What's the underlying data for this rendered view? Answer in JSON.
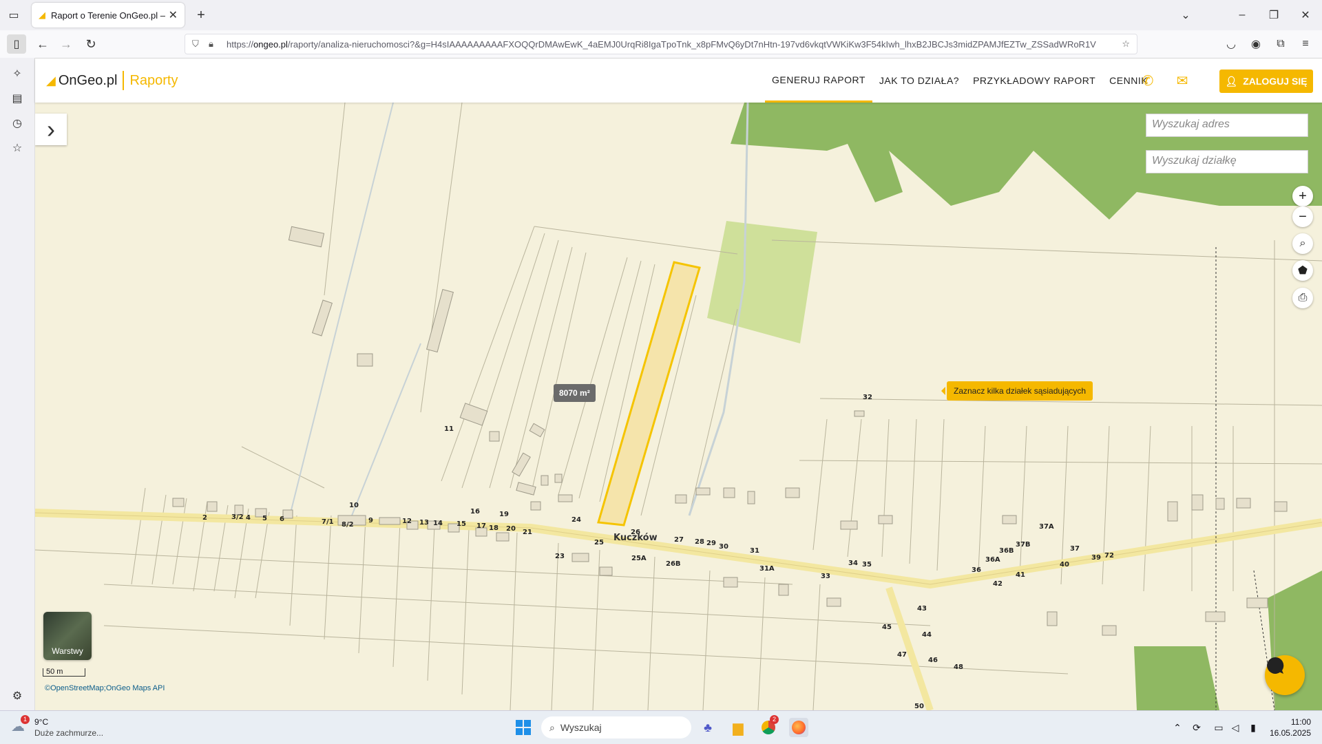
{
  "browser": {
    "tab_title": "Raport o Terenie OnGeo.pl – An",
    "new_tab_label": "+",
    "url_prefix": "https://",
    "url_domain": "ongeo.pl",
    "url_rest": "/raporty/analiza-nieruchomosci?&g=H4sIAAAAAAAAAFXOQQrDMAwEwK_4aEMJ0UrqRi8IgaTpoTnk_x8pFMvQ6yDt7nHtn-197vd6vkqtVWKiKw3F54kIwh_lhxB2JBCJs3midZPAMJfEZTw_ZSSadWRoR1V"
  },
  "site": {
    "logo_brand": "OnGeo.pl",
    "logo_section": "Raporty",
    "nav": [
      "GENERUJ RAPORT",
      "JAK TO DZIAŁA?",
      "PRZYKŁADOWY RAPORT",
      "CENNIK"
    ],
    "login_label": "ZALOGUJ SIĘ",
    "accent_color": "#f5b800"
  },
  "map": {
    "search_address_placeholder": "Wyszukaj adres",
    "search_parcel_placeholder": "Wyszukaj działkę",
    "area_label": "8070 m²",
    "hint_label": "Zaznacz kilka działek sąsiadujących",
    "layers_label": "Warstwy",
    "scale_label": "50 m",
    "attribution": "©OpenStreetMap;OnGeo Maps API",
    "street_label": "Kuczków",
    "house_numbers": [
      "2",
      "3/2",
      "4",
      "5",
      "6",
      "7/1",
      "8/2",
      "9",
      "10",
      "11",
      "12",
      "13",
      "14",
      "15",
      "16",
      "17",
      "18",
      "19",
      "20",
      "21",
      "23",
      "24",
      "25",
      "25A",
      "26",
      "26B",
      "27",
      "28",
      "29",
      "30",
      "31",
      "31A",
      "32",
      "33",
      "34",
      "35",
      "36",
      "36A",
      "36B",
      "37",
      "37A",
      "37B",
      "39",
      "40",
      "41",
      "42",
      "43",
      "44",
      "45",
      "46",
      "47",
      "48",
      "50",
      "72"
    ]
  },
  "taskbar": {
    "weather_temp": "9°C",
    "weather_desc": "Duże zachmurze...",
    "search_label": "Wyszukaj",
    "time": "11:00",
    "date": "16.05.2025",
    "weather_badge": "1",
    "chrome_badge": "2"
  }
}
